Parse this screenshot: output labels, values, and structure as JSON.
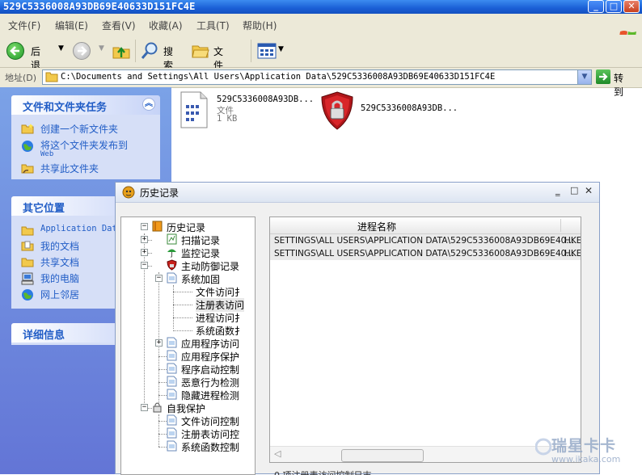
{
  "window": {
    "title": "529C5336008A93DB69E40633D151FC4E",
    "minimize": "_",
    "maximize": "□",
    "close": "✕"
  },
  "menu": [
    "文件(F)",
    "编辑(E)",
    "查看(V)",
    "收藏(A)",
    "工具(T)",
    "帮助(H)"
  ],
  "toolbar": {
    "back": "后退",
    "search": "搜索",
    "folders": "文件夹"
  },
  "address": {
    "label": "地址(D)",
    "value": "C:\\Documents and Settings\\All Users\\Application Data\\529C5336008A93DB69E40633D151FC4E",
    "go": "转到"
  },
  "tasks": {
    "heading": "文件和文件夹任务",
    "items": [
      "创建一个新文件夹",
      "将这个文件夹发布到",
      "Web",
      "共享此文件夹"
    ]
  },
  "places": {
    "heading": "其它位置",
    "items": [
      "Application Data",
      "我的文档",
      "共享文档",
      "我的电脑",
      "网上邻居"
    ]
  },
  "details": {
    "heading": "详细信息"
  },
  "files": [
    {
      "name": "529C5336008A93DB...",
      "type": "文件",
      "size": "1 KB"
    },
    {
      "name": "529C5336008A93DB..."
    }
  ],
  "dialog": {
    "title": "历史记录",
    "tree": {
      "root": "历史记录",
      "scan": "扫描记录",
      "monitor": "监控记录",
      "defense": "主动防御记录",
      "hardening": "系统加固",
      "file_access": "文件访问扌",
      "registry_access": "注册表访问",
      "process_access": "进程访问扌",
      "syscall": "系统函数扌",
      "app_access": "应用程序访问",
      "app_protect": "应用程序保护",
      "app_launch": "程序启动控制",
      "malicious": "恶意行为检测",
      "hidden_process": "隐藏进程检测",
      "self_protect": "自我保护",
      "self_file": "文件访问控制",
      "self_registry": "注册表访问控",
      "self_syscall": "系统函数控制"
    },
    "list": {
      "column": "进程名称",
      "rows": [
        {
          "path": "SETTINGS\\ALL USERS\\APPLICATION DATA\\529C5336008A93DB69E40...",
          "extra": "HKE"
        },
        {
          "path": "SETTINGS\\ALL USERS\\APPLICATION DATA\\529C5336008A93DB69E40...",
          "extra": "HKE"
        }
      ]
    },
    "footer_text": "0 项注册表访问控制日志"
  },
  "watermark": {
    "brand": "瑞星卡卡",
    "url": "www.ikaka.com"
  }
}
